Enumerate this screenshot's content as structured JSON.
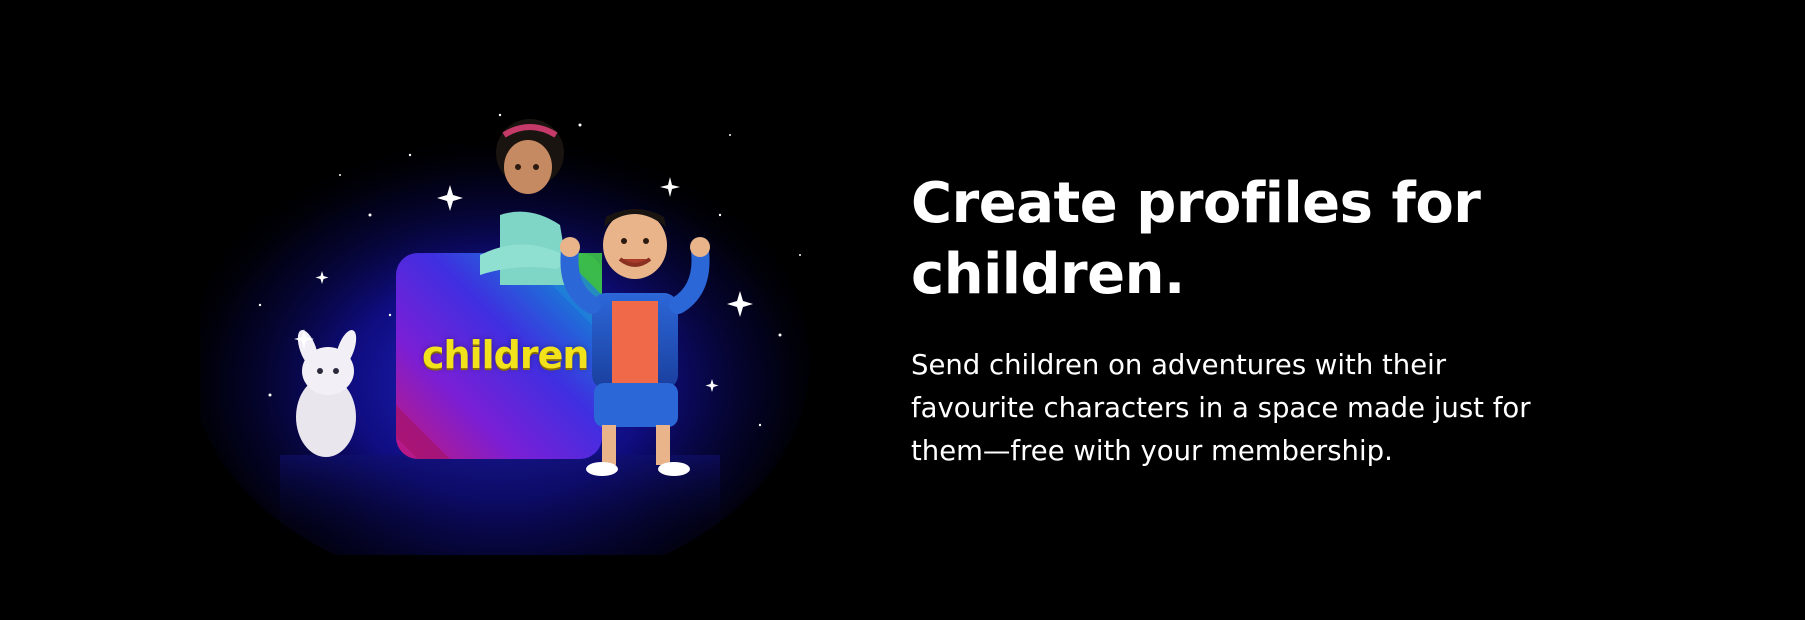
{
  "hero": {
    "tile_label": "children",
    "headline": "Create profiles for children.",
    "body": "Send children on adventures with their favourite characters in a space made just for them—free with your membership."
  },
  "icons": {
    "tile": "children-profile-tile-icon",
    "girl": "girl-character",
    "boy": "boy-character",
    "bunny": "bunny-character",
    "stars": "sparkle-icon"
  },
  "colors": {
    "background": "#000000",
    "glow": "#1d1fb8",
    "tile_purple": "#7a1fd6",
    "tile_blue": "#1e6fd8",
    "tile_green": "#3ec23a",
    "tile_label": "#f2e21b",
    "text": "#ffffff"
  }
}
